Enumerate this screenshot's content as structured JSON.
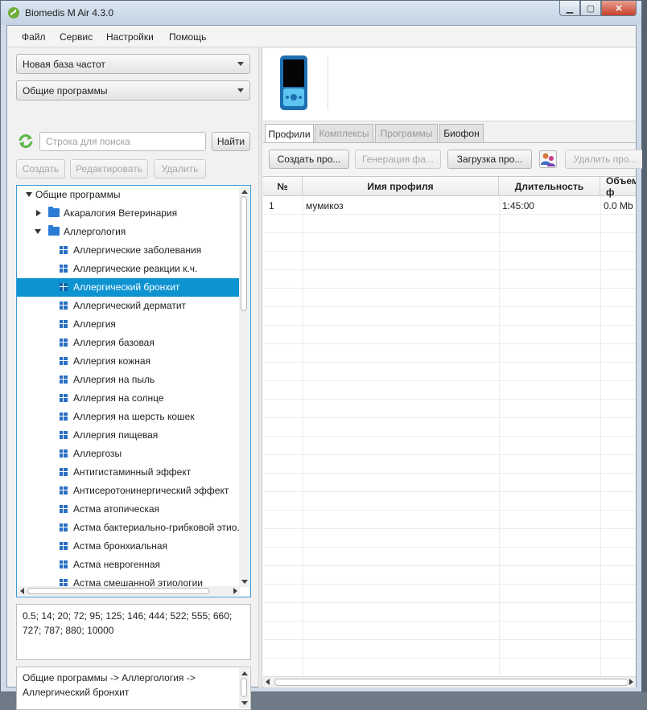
{
  "window": {
    "title": "Biomedis M Air 4.3.0",
    "controls": {
      "minimize": "▁",
      "maximize": "▢",
      "close": "✕"
    }
  },
  "menu": [
    "Файл",
    "Сервис",
    "Настройки",
    "Помощь"
  ],
  "left": {
    "base_combo": "Новая база частот",
    "programs_combo": "Общие программы",
    "search": {
      "placeholder": "Строка для поиска",
      "value": "",
      "button": "Найти"
    },
    "actions": {
      "create": "Создать",
      "edit": "Редактировать",
      "delete": "Удалить"
    },
    "tree": {
      "root": "Общие программы",
      "folders": [
        "Акаралогия Ветеринария",
        "Аллергология"
      ],
      "items": [
        "Аллергические заболевания",
        "Аллергические реакции к.ч.",
        "Аллергический бронхит",
        "Аллергический дерматит",
        "Аллергия",
        "Аллергия базовая",
        "Аллергия кожная",
        "Аллергия на пыль",
        "Аллергия на солнце",
        "Аллергия на шерсть кошек",
        "Аллергия пищевая",
        "Аллергозы",
        "Антигистаминный эффект",
        "Антисеротонинергический эффект",
        "Астма атопическая",
        "Астма бактериально-грибковой этио.",
        "Астма бронхиальная",
        "Астма неврогенная",
        "Астма смешанной этиологии"
      ],
      "selected": "Аллергический бронхит"
    },
    "frequencies": "0.5;  14;  20;  72;  95;  125;  146;  444;  522;  555;  660;  727;  787;  880;  10000",
    "path": "Общие программы -> Аллергология -> Аллергический бронхит"
  },
  "right": {
    "tabs": [
      "Профили",
      "Комплексы",
      "Программы",
      "Биофон"
    ],
    "active_tab": "Профили",
    "toolbar": {
      "create_profile": "Создать про...",
      "generate": "Генерация фа...",
      "load_profile": "Загрузка про...",
      "delete_profile": "Удалить про..."
    },
    "table": {
      "headers": [
        "№",
        "Имя профиля",
        "Длительность",
        "Объем ф"
      ],
      "rows": [
        [
          "1",
          "мумикоз",
          "1:45:00",
          "0.0 Mb"
        ]
      ]
    }
  },
  "colors": {
    "selection": "#0e93d1",
    "folder": "#2a7bd6",
    "tree_border": "#3c9bd6",
    "device_body": "#1e6fb0"
  }
}
